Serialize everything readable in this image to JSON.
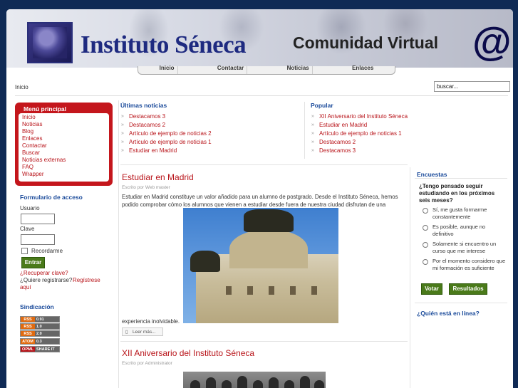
{
  "banner": {
    "site_title": "Instituto Séneca",
    "slogan": "Comunidad Virtual",
    "at_symbol": "@"
  },
  "topnav": [
    "Inicio",
    "Contactar",
    "Noticias",
    "Enlaces"
  ],
  "breadcrumb": "Inicio",
  "search": {
    "value": "buscar..."
  },
  "main_menu": {
    "title": "Menú principal",
    "items": [
      "Inicio",
      "Noticias",
      "Blog",
      "Enlaces",
      "Contactar",
      "Buscar",
      "Noticias externas",
      "FAQ",
      "Wrapper"
    ]
  },
  "login": {
    "title": "Formulario de acceso",
    "username_label": "Usuario",
    "password_label": "Clave",
    "remember_label": "Recordarme",
    "submit": "Entrar",
    "forgot": "¿Recuperar clave?",
    "register_prefix": "¿Quiere registrarse?",
    "register_link": "Regístrese",
    "register_suffix": "aquí"
  },
  "syndication": {
    "title": "Sindicación",
    "feeds": [
      {
        "badge": "RSS",
        "version": "0.91"
      },
      {
        "badge": "RSS",
        "version": "1.0"
      },
      {
        "badge": "RSS",
        "version": "2.0"
      },
      {
        "badge": "ATOM",
        "version": "0.3"
      },
      {
        "badge": "OPML",
        "version": "SHARE IT"
      }
    ]
  },
  "latest_news": {
    "title": "Últimas noticias",
    "items": [
      "Destacamos 3",
      "Destacamos 2",
      "Artículo de ejemplo de noticias 2",
      "Artículo de ejemplo de noticias 1",
      "Estudiar en Madrid"
    ]
  },
  "popular": {
    "title": "Popular",
    "items": [
      "XII Aniversario del Instituto Séneca",
      "Estudiar en Madrid",
      "Artículo de ejemplo de noticias 1",
      "Destacamos 2",
      "Destacamos 3"
    ]
  },
  "articles": [
    {
      "title": "Estudiar en Madrid",
      "meta": "Escrito por Web master",
      "body": "Estudiar en Madrid constituye un valor añadido para un alumno de postgrado. Desde el Instituto Séneca, hemos podido comprobar cómo los alumnos que vienen a estudiar desde fuera de nuestra ciudad disfrutan de una",
      "body_end": "experiencia inolvidable.",
      "read_more": "Leer más..."
    },
    {
      "title": "XII Aniversario del Instituto Séneca",
      "meta": "Escrito por Administrator"
    }
  ],
  "poll": {
    "title": "Encuestas",
    "question": "¿Tengo pensado seguir estudiando en los próximos seis meses?",
    "options": [
      "Sí, me gusta formarme constantemente",
      "Es posible, aunque no definitivo",
      "Solamente si encuentro un curso que me interese",
      "Por el momento considero que mi formación es suficiente"
    ],
    "vote": "Votar",
    "results": "Resultados"
  },
  "who_online": {
    "title": "¿Quién está en línea?"
  }
}
